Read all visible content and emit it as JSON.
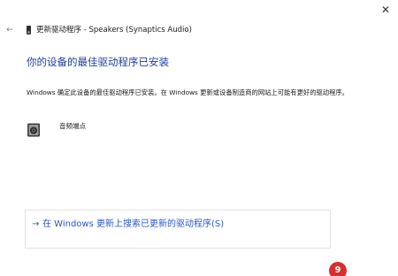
{
  "window": {
    "close_glyph": "✕",
    "back_glyph": "←",
    "title": "更新驱动程序 - Speakers (Synaptics Audio)"
  },
  "main": {
    "heading": "你的设备的最佳驱动程序已安装",
    "description": "Windows 确定此设备的最佳驱动程序已安装。在 Windows 更新或设备制造商的网站上可能有更好的驱动程序。",
    "device_name": "音频端点",
    "search_link": {
      "arrow": "→",
      "label": "在 Windows 更新上搜索已更新的驱动程序(S)"
    }
  },
  "annotation": {
    "badge_number": "9"
  },
  "colors": {
    "heading": "#1f3fa0",
    "link": "#2b57c8",
    "badge": "#d72f2f"
  },
  "icons": {
    "close": "close-icon",
    "back": "back-arrow-icon",
    "device": "speaker-device-icon"
  }
}
